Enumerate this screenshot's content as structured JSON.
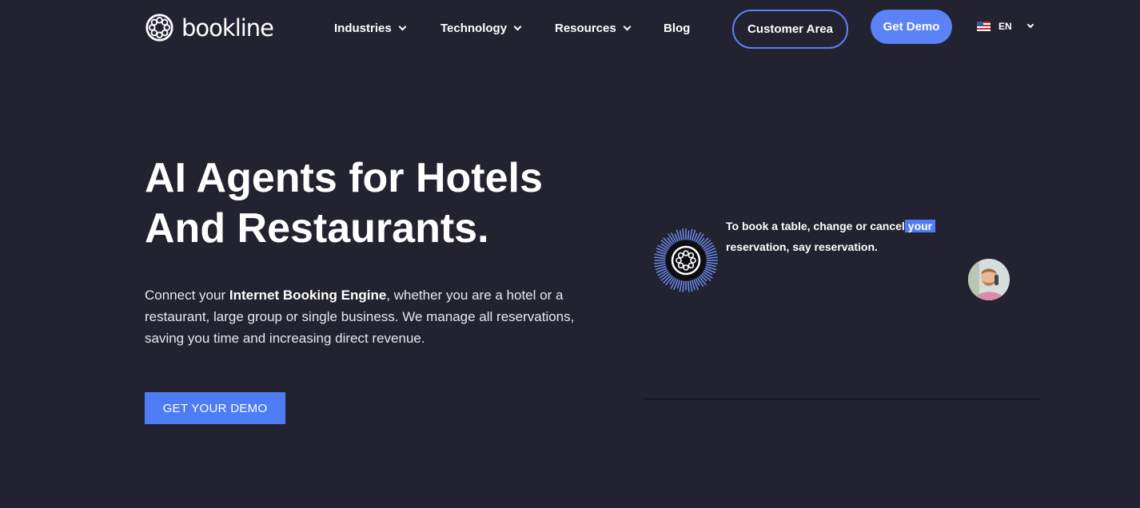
{
  "brand": {
    "name": "bookline"
  },
  "nav": {
    "items": [
      {
        "label": "Industries",
        "dropdown": true
      },
      {
        "label": "Technology",
        "dropdown": true
      },
      {
        "label": "Resources",
        "dropdown": true
      },
      {
        "label": "Blog",
        "dropdown": false
      }
    ],
    "customer_area": "Customer Area",
    "get_demo": "Get Demo",
    "language": "EN"
  },
  "hero": {
    "title_line1": "AI Agents for Hotels",
    "title_line2": "And Restaurants.",
    "lead_prefix": "Connect your ",
    "lead_bold": "Internet Booking Engine",
    "lead_suffix": ", whether you are a hotel or a restaurant, large group or single business. We manage all reservations, saving you time and increasing direct revenue.",
    "cta": "GET YOUR DEMO"
  },
  "demo": {
    "transcript_before": "To book a table, change or cancel",
    "transcript_highlight": "your",
    "transcript_after": "reservation, say reservation."
  },
  "colors": {
    "background": "#222231",
    "accent": "#5b82f6",
    "cta": "#4d7cf5"
  },
  "icons": [
    "bookline-logo-icon",
    "chevron-down-icon",
    "us-flag-icon",
    "voice-agent-burst-icon",
    "caller-avatar"
  ]
}
